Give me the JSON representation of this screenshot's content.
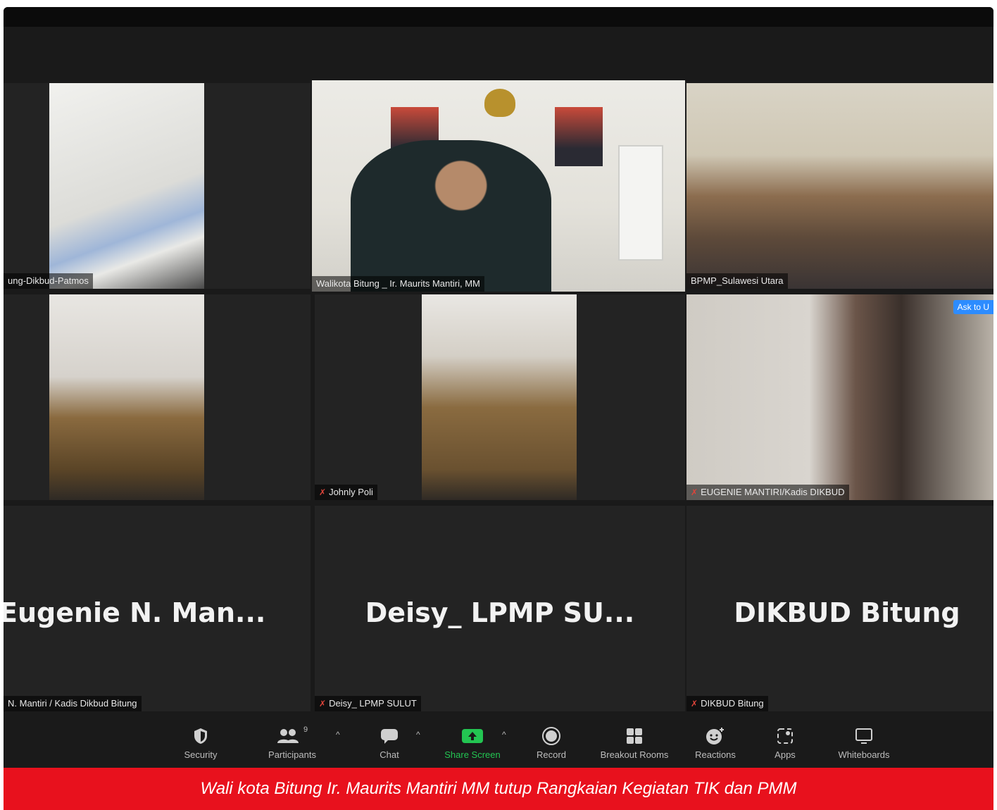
{
  "participants": {
    "tile1": {
      "name": "ung-Dikbud-Patmos"
    },
    "tile2": {
      "name": "Walikota Bitung _ Ir. Maurits Mantiri, MM"
    },
    "tile3": {
      "name": "BPMP_Sulawesi Utara"
    },
    "tile5": {
      "name": "Johnly Poli"
    },
    "tile6": {
      "name": "EUGENIE MANTIRI/Kadis DIKBUD",
      "ask": "Ask to U"
    },
    "tile7": {
      "big": "Eugenie N. Man...",
      "name": "N. Mantiri / Kadis Dikbud Bitung"
    },
    "tile8": {
      "big": "Deisy_ LPMP SU...",
      "name": "Deisy_ LPMP SULUT"
    },
    "tile9": {
      "big": "DIKBUD Bitung",
      "name": "DIKBUD Bitung"
    }
  },
  "toolbar": {
    "security": "Security",
    "participants": "Participants",
    "participants_count": "9",
    "chat": "Chat",
    "share": "Share Screen",
    "record": "Record",
    "breakout": "Breakout Rooms",
    "reactions": "Reactions",
    "apps": "Apps",
    "whiteboards": "Whiteboards"
  },
  "caption": "Wali kota Bitung Ir. Maurits Mantiri MM tutup Rangkaian Kegiatan TIK dan PMM",
  "colors": {
    "active_border": "#b9d95a",
    "caption_bg": "#e8111d",
    "share_green": "#23c552",
    "ask_blue": "#2d8cff"
  }
}
